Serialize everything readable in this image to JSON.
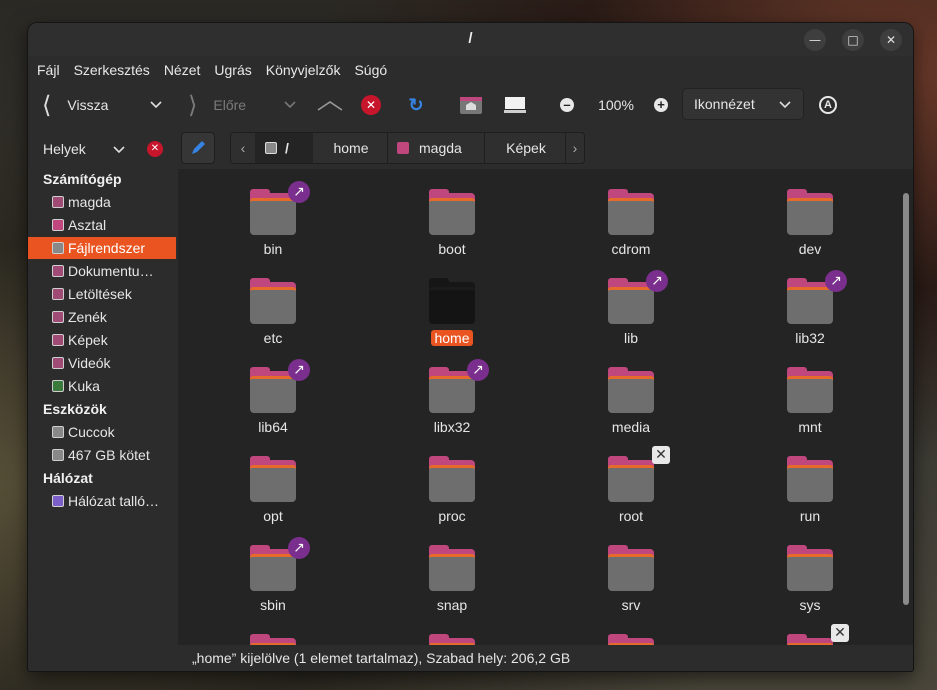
{
  "window": {
    "title": "/"
  },
  "menu": [
    "Fájl",
    "Szerkesztés",
    "Nézet",
    "Ugrás",
    "Könyvjelzők",
    "Súgó"
  ],
  "toolbar": {
    "back_label": "Vissza",
    "forward_label": "Előre",
    "zoom_level": "100%",
    "view_mode": "Ikonnézet"
  },
  "places": {
    "label": "Helyek"
  },
  "breadcrumb": [
    "/",
    "home",
    "magda",
    "Képek"
  ],
  "sidebar": {
    "sections": [
      {
        "title": "Számítógép",
        "items": [
          "magda",
          "Asztal",
          "Fájlrendszer",
          "Dokumentu…",
          "Letöltések",
          "Zenék",
          "Képek",
          "Videók",
          "Kuka"
        ]
      },
      {
        "title": "Eszközök",
        "items": [
          "Cuccok",
          "467 GB kötet"
        ]
      },
      {
        "title": "Hálózat",
        "items": [
          "Hálózat talló…"
        ]
      }
    ],
    "selected": "Fájlrendszer"
  },
  "files": [
    {
      "name": "bin",
      "emblem": "symlink"
    },
    {
      "name": "boot",
      "emblem": ""
    },
    {
      "name": "cdrom",
      "emblem": ""
    },
    {
      "name": "dev",
      "emblem": ""
    },
    {
      "name": "etc",
      "emblem": ""
    },
    {
      "name": "home",
      "emblem": "",
      "selected": true
    },
    {
      "name": "lib",
      "emblem": "symlink"
    },
    {
      "name": "lib32",
      "emblem": "symlink"
    },
    {
      "name": "lib64",
      "emblem": "symlink"
    },
    {
      "name": "libx32",
      "emblem": "symlink"
    },
    {
      "name": "media",
      "emblem": ""
    },
    {
      "name": "mnt",
      "emblem": ""
    },
    {
      "name": "opt",
      "emblem": ""
    },
    {
      "name": "proc",
      "emblem": ""
    },
    {
      "name": "root",
      "emblem": "locked"
    },
    {
      "name": "run",
      "emblem": ""
    },
    {
      "name": "sbin",
      "emblem": "symlink"
    },
    {
      "name": "snap",
      "emblem": ""
    },
    {
      "name": "srv",
      "emblem": ""
    },
    {
      "name": "sys",
      "emblem": ""
    }
  ],
  "status": {
    "text": "„home” kijelölve (1 elemet tartalmaz), Szabad hely: 206,2 GB"
  },
  "colors": {
    "accent": "#e95420",
    "folder_tab": "#c0467e",
    "folder_stripe": "#e56a2c",
    "folder_body": "#6e6e6e",
    "emblem": "#7a2e8d"
  }
}
